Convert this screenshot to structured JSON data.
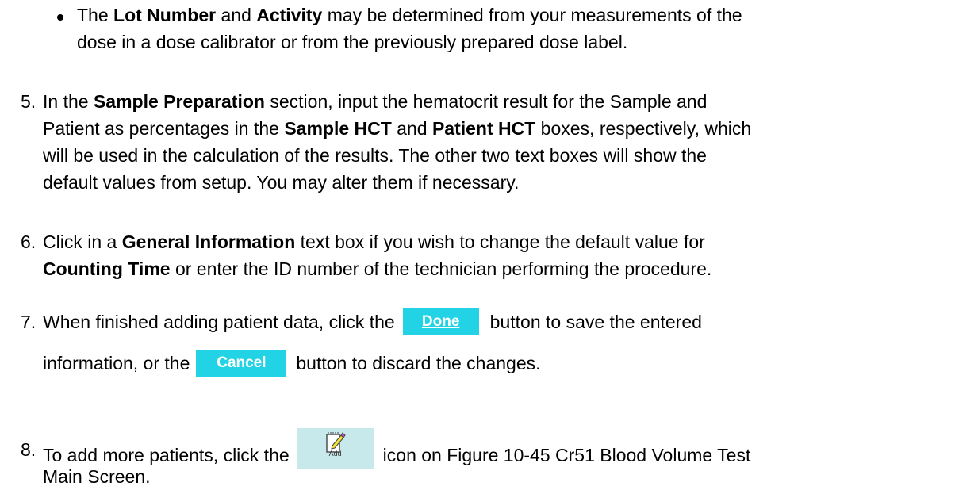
{
  "bullet": {
    "t1": "The ",
    "b1": "Lot Number",
    "t2": " and ",
    "b2": "Activity",
    "t3": " may be determined from your measurements of the",
    "line2": "dose in a dose calibrator or from the previously prepared dose label."
  },
  "step5": {
    "num": "5.",
    "t1": "In the ",
    "b1": "Sample Preparation",
    "t2": " section, input the hematocrit result for the Sample and",
    "t3": "Patient as percentages in the ",
    "b2": "Sample HCT",
    "t4": " and ",
    "b3": "Patient HCT",
    "t5": " boxes, respectively, which",
    "line3": "will be used in the calculation of the results. The other two text boxes will show the",
    "line4": "default values from setup. You may alter them if necessary."
  },
  "step6": {
    "num": "6.",
    "t1": "Click in a ",
    "b1": "General Information",
    "t2": " text box if you wish to change the default value for",
    "b2": "Counting Time",
    "t3": " or enter the ID number of the technician performing the procedure."
  },
  "step7": {
    "num": "7.",
    "t1": "When finished adding patient data, click the",
    "done_label": "Done",
    "t2": "button to save the entered",
    "t3": "information, or the",
    "cancel_label": "Cancel",
    "t4": "button to discard the changes."
  },
  "step8": {
    "num": "8.",
    "t1": "To add more patients, click the",
    "add_label": "Add",
    "t2": "icon on Figure 10-45  Cr51 Blood Volume Test",
    "line2": "Main Screen."
  },
  "colors": {
    "button_bg": "#22d3e6",
    "add_icon_bg": "#c8e9ec"
  },
  "icons": {
    "add_icon": "notepad-pencil-icon"
  }
}
